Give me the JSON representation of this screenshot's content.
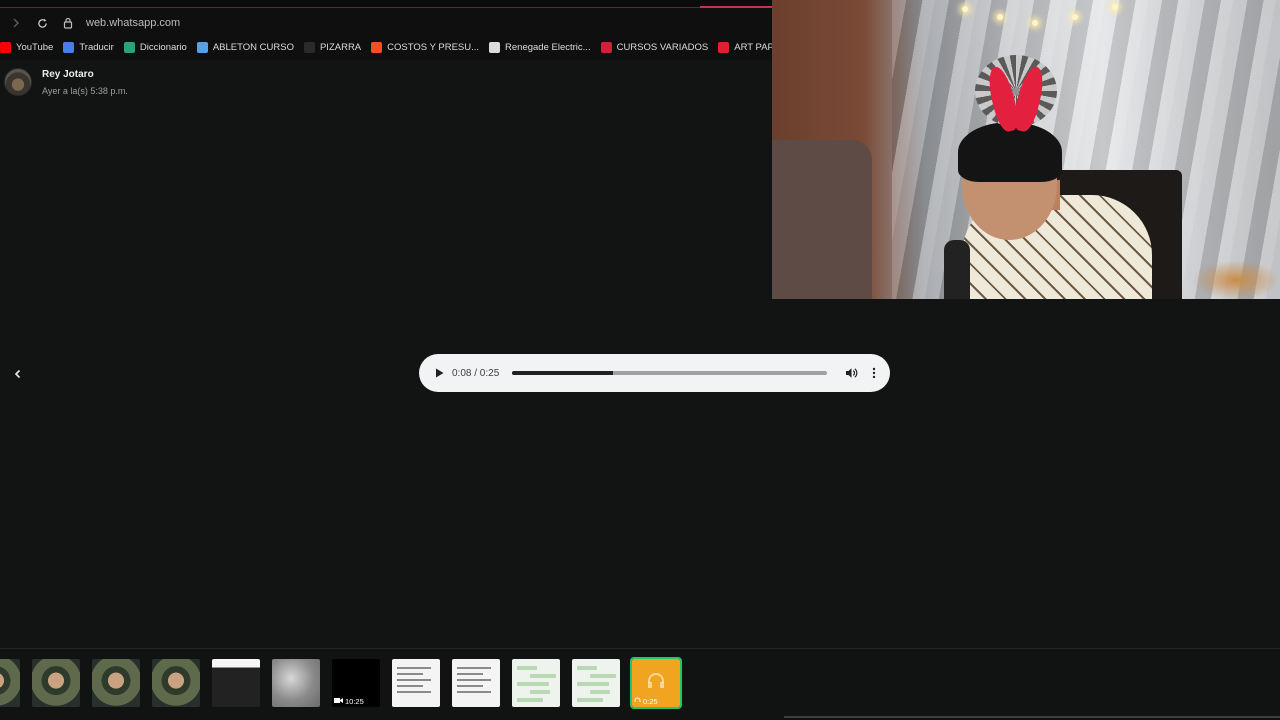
{
  "browser": {
    "url": "web.whatsapp.com",
    "bookmarks": [
      {
        "label": "YouTube",
        "color": "#ff0000"
      },
      {
        "label": "Traducir",
        "color": "#4a7de8"
      },
      {
        "label": "Diccionario",
        "color": "#2aa37a"
      },
      {
        "label": "ABLETON CURSO",
        "color": "#5aa0e6"
      },
      {
        "label": "PIZARRA",
        "color": "#2a2a2a"
      },
      {
        "label": "COSTOS Y PRESU...",
        "color": "#f25022"
      },
      {
        "label": "Renegade Electric...",
        "color": "#dcdcdc"
      },
      {
        "label": "CURSOS VARIADOS",
        "color": "#d0203a"
      },
      {
        "label": "ART PAPER SELLO",
        "color": "#e0202e"
      }
    ]
  },
  "chat": {
    "sender": "Rey Jotaro",
    "timestamp": "Ayer a la(s) 5:38 p.m."
  },
  "player": {
    "time_display": "0:08 / 0:25",
    "progress_fraction": 0.32
  },
  "thumbnails": [
    {
      "kind": "face",
      "caption": ""
    },
    {
      "kind": "face",
      "caption": ""
    },
    {
      "kind": "face",
      "caption": ""
    },
    {
      "kind": "face",
      "caption": ""
    },
    {
      "kind": "photo",
      "caption": ""
    },
    {
      "kind": "gray",
      "caption": ""
    },
    {
      "kind": "video",
      "caption": "10:25"
    },
    {
      "kind": "doc",
      "caption": ""
    },
    {
      "kind": "doc",
      "caption": ""
    },
    {
      "kind": "chat",
      "caption": ""
    },
    {
      "kind": "chat",
      "caption": ""
    },
    {
      "kind": "audio",
      "caption": "0:25",
      "selected": true
    }
  ],
  "colors": {
    "background": "#121414",
    "selected_outline": "#1fc76a",
    "audio_thumb": "#f0a41f"
  }
}
